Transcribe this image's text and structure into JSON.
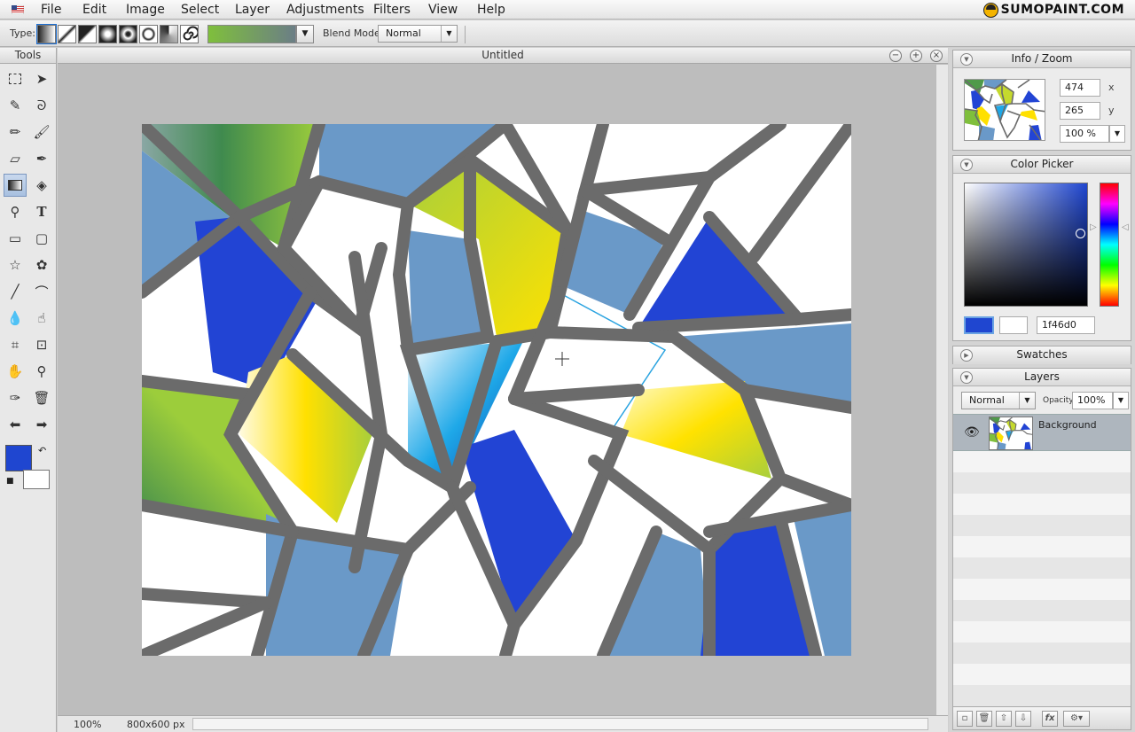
{
  "menubar": {
    "items": [
      "File",
      "Edit",
      "Image",
      "Select",
      "Layer",
      "Adjustments",
      "Filters",
      "View",
      "Help"
    ],
    "logo": "SUMOPAINT.COM"
  },
  "optionsbar": {
    "type_label": "Type:",
    "blend_mode_label": "Blend Mode:",
    "blend_mode_value": "Normal"
  },
  "tools": {
    "title": "Tools"
  },
  "document": {
    "title": "Untitled",
    "zoom": "100%",
    "size": "800x600 px",
    "colors": {
      "gray": "#6b6b6b",
      "slate": "#6a99c8",
      "blue": "#2244d4",
      "white": "#ffffff"
    }
  },
  "info_zoom": {
    "title": "Info / Zoom",
    "x_value": "474",
    "x_label": "x",
    "y_value": "265",
    "y_label": "y",
    "zoom_value": "100 %"
  },
  "color_picker": {
    "title": "Color Picker",
    "hex": "1f46d0",
    "foreground": "#1f46d0",
    "background": "#ffffff"
  },
  "swatches": {
    "title": "Swatches"
  },
  "layers": {
    "title": "Layers",
    "blend_mode": "Normal",
    "opacity_label": "Opacity:",
    "opacity_value": "100%",
    "items": [
      {
        "name": "Background",
        "visible": true
      }
    ]
  }
}
